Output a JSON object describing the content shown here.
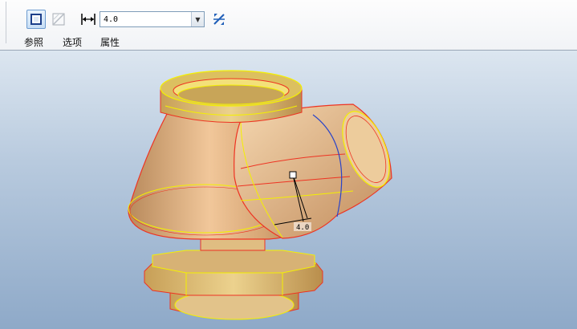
{
  "toolbar": {
    "solid_icon": "solid-extrude-icon",
    "surface_icon": "surface-icon",
    "thickness_icon": "thickness-dimension-icon",
    "thickness_value": "4.0",
    "flip_icon": "flip-direction-icon",
    "tabs": [
      {
        "label": "参照"
      },
      {
        "label": "选项"
      },
      {
        "label": "属性"
      }
    ]
  },
  "viewport": {
    "dimension_label": "4.0",
    "colors": {
      "background_top": "#dce6f0",
      "background_bottom": "#8ea9c8",
      "body_fill": "#d4a77a",
      "edge_red": "#ee3322",
      "edge_yellow": "#f4f000",
      "selected_edge": "#2a44c8"
    }
  }
}
